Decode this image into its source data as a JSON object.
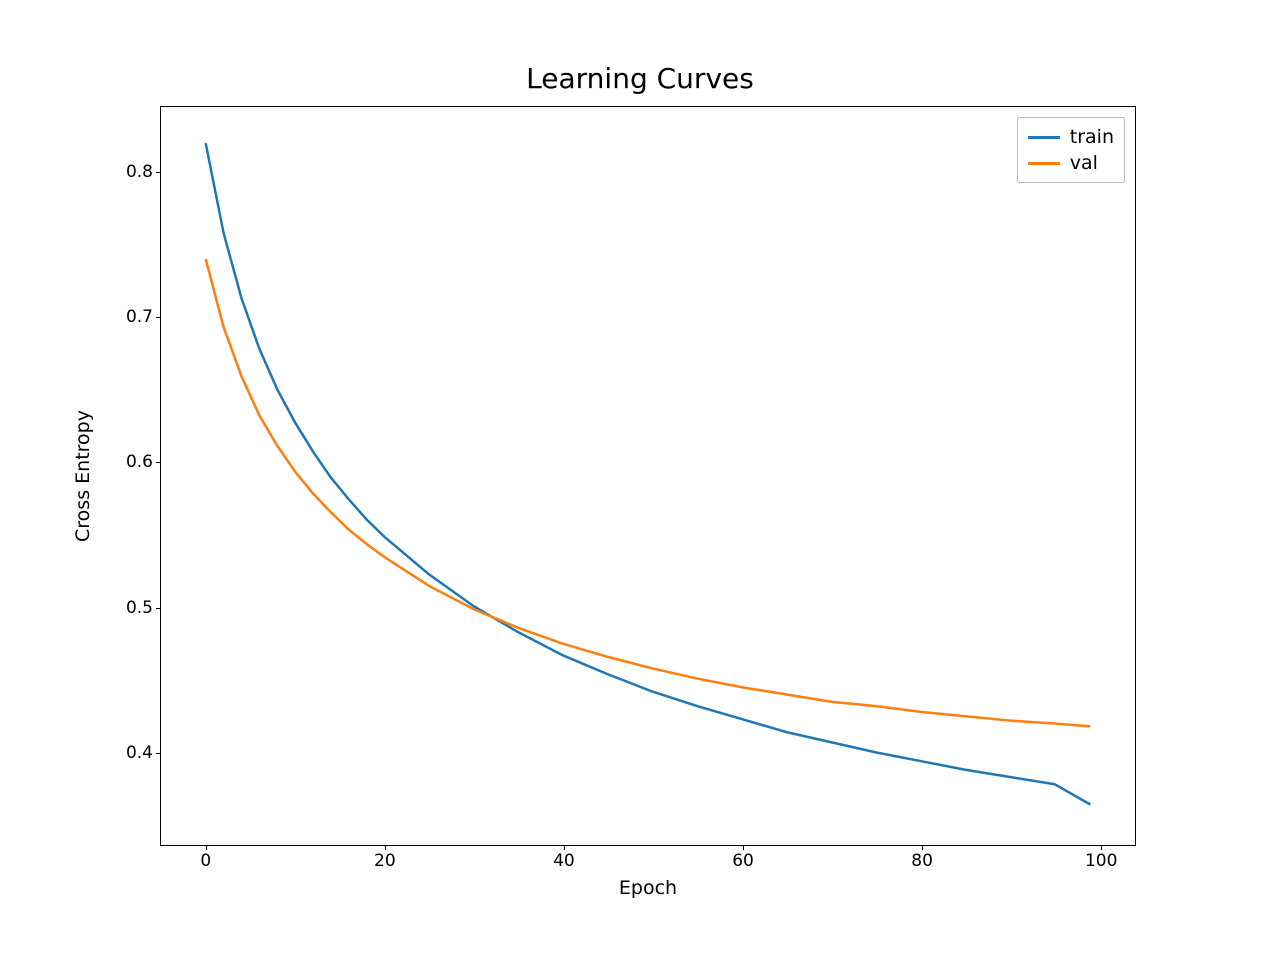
{
  "chart_data": {
    "type": "line",
    "title": "Learning Curves",
    "xlabel": "Epoch",
    "ylabel": "Cross Entropy",
    "xlim": [
      -5,
      104
    ],
    "ylim": [
      0.335,
      0.845
    ],
    "xticks": [
      0,
      20,
      40,
      60,
      80,
      100
    ],
    "yticks": [
      0.4,
      0.5,
      0.6,
      0.7,
      0.8
    ],
    "legend_position": "upper right",
    "series": [
      {
        "name": "train",
        "color": "#1f77b4",
        "x": [
          0,
          2,
          4,
          6,
          8,
          10,
          12,
          14,
          16,
          18,
          20,
          25,
          30,
          35,
          40,
          45,
          50,
          55,
          60,
          65,
          70,
          75,
          80,
          85,
          90,
          95,
          99
        ],
        "y": [
          0.82,
          0.758,
          0.713,
          0.678,
          0.65,
          0.627,
          0.607,
          0.589,
          0.574,
          0.56,
          0.548,
          0.522,
          0.5,
          0.482,
          0.466,
          0.453,
          0.441,
          0.431,
          0.422,
          0.413,
          0.406,
          0.399,
          0.393,
          0.387,
          0.382,
          0.377,
          0.363
        ]
      },
      {
        "name": "val",
        "color": "#ff7f0e",
        "x": [
          0,
          2,
          4,
          6,
          8,
          10,
          12,
          14,
          16,
          18,
          20,
          25,
          30,
          35,
          40,
          45,
          50,
          55,
          60,
          65,
          70,
          75,
          80,
          85,
          90,
          95,
          99
        ],
        "y": [
          0.74,
          0.693,
          0.659,
          0.632,
          0.611,
          0.593,
          0.578,
          0.565,
          0.553,
          0.543,
          0.534,
          0.514,
          0.498,
          0.485,
          0.474,
          0.465,
          0.457,
          0.45,
          0.444,
          0.439,
          0.434,
          0.431,
          0.427,
          0.424,
          0.421,
          0.419,
          0.417
        ]
      }
    ]
  }
}
